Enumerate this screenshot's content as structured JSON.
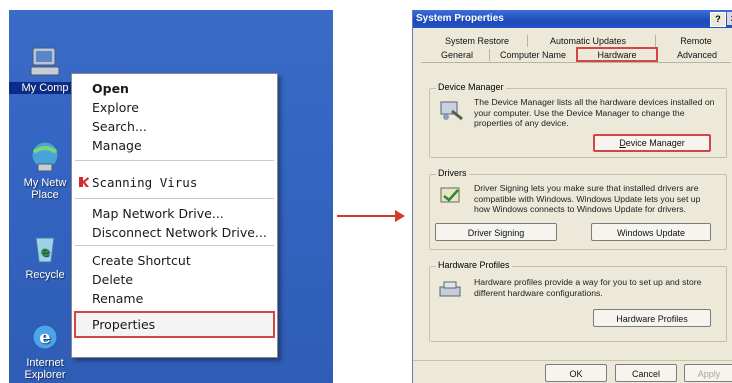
{
  "desktop": {
    "icons": [
      {
        "label": "My Comp",
        "icon": "my-computer-icon"
      },
      {
        "label": "My Netw\nPlace",
        "icon": "my-network-places-icon"
      },
      {
        "label": "Recycle",
        "icon": "recycle-bin-icon"
      },
      {
        "label": "Internet\nExplorer",
        "icon": "internet-explorer-icon"
      }
    ],
    "background_color": "#3465c2"
  },
  "context_menu": {
    "open": "Open",
    "explore": "Explore",
    "search": "Search...",
    "manage": "Manage",
    "scanning_virus": "Scanning Virus",
    "map_network_drive": "Map Network Drive...",
    "disconnect_network_drive": "Disconnect Network Drive...",
    "create_shortcut": "Create Shortcut",
    "delete": "Delete",
    "rename": "Rename",
    "properties": "Properties",
    "highlight_color": "#d64545"
  },
  "dialog": {
    "title": "System Properties",
    "help": "?",
    "close": "x",
    "tabs_top": [
      "System Restore",
      "Automatic Updates",
      "Remote"
    ],
    "tabs_bottom": [
      "General",
      "Computer Name",
      "Hardware",
      "Advanced"
    ],
    "active_tab": "Hardware",
    "device_manager": {
      "title": "Device Manager",
      "text": "The Device Manager lists all the hardware devices installed on your computer. Use the Device Manager to change the properties of any device.",
      "button": "Device Manager",
      "button_underline": "D"
    },
    "drivers": {
      "title": "Drivers",
      "text": "Driver Signing lets you make sure that installed drivers are compatible with Windows. Windows Update lets you set up how Windows connects to Windows Update for drivers.",
      "button_signing": "Driver Signing",
      "button_update": "Windows Update"
    },
    "hardware_profiles": {
      "title": "Hardware Profiles",
      "text": "Hardware profiles provide a way for you to set up and store different hardware configurations.",
      "button": "Hardware Profiles"
    },
    "footer": {
      "ok": "OK",
      "cancel": "Cancel",
      "apply": "Apply"
    }
  }
}
